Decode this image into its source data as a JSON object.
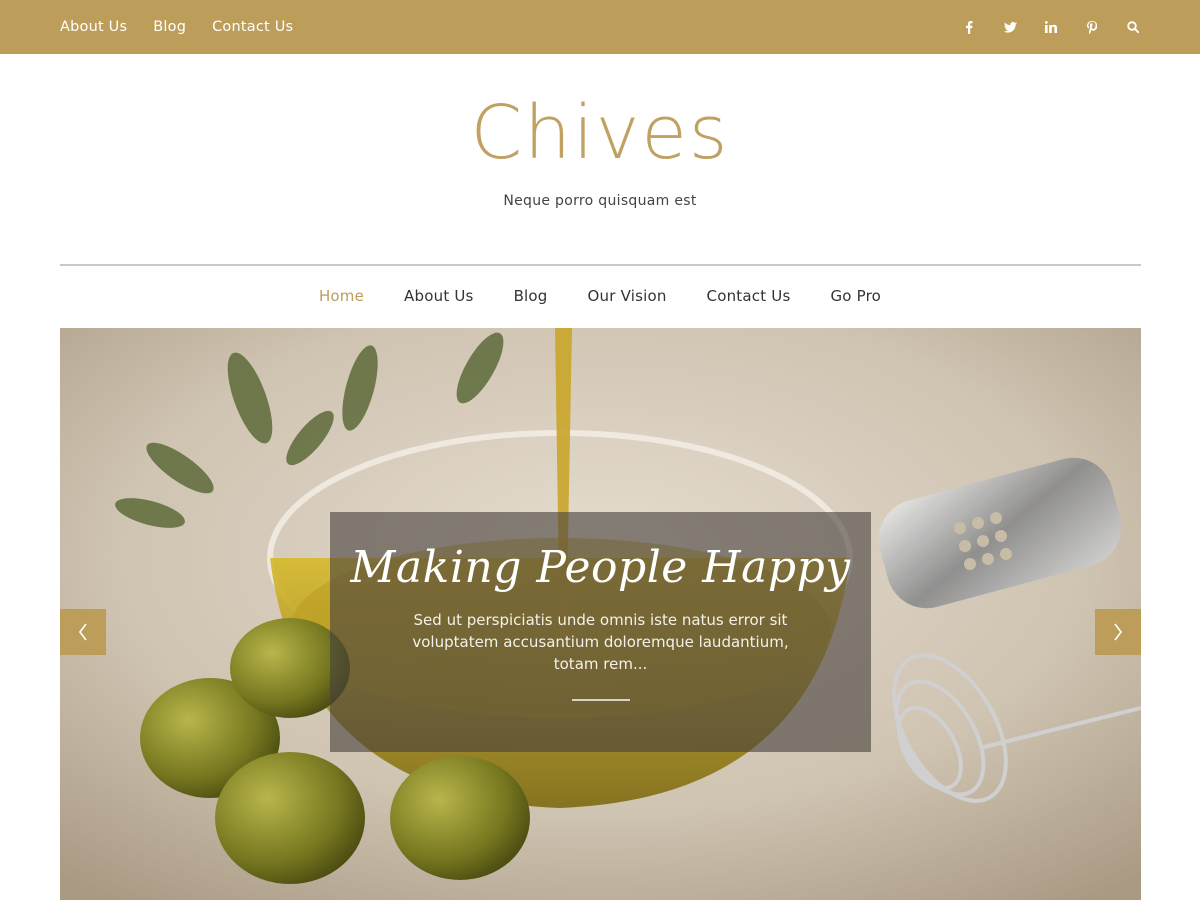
{
  "topbar": {
    "links": [
      "About Us",
      "Blog",
      "Contact Us"
    ],
    "icons": [
      "facebook-icon",
      "twitter-icon",
      "linkedin-icon",
      "pinterest-icon",
      "search-icon"
    ]
  },
  "site": {
    "title": "Chives",
    "tagline": "Neque porro quisquam est"
  },
  "nav": {
    "items": [
      "Home",
      "About Us",
      "Blog",
      "Our Vision",
      "Contact Us",
      "Go Pro"
    ],
    "active": "Home"
  },
  "slider": {
    "title": "Making People Happy",
    "text": "Sed ut perspiciatis unde omnis iste natus error sit voluptatem accusantium doloremque laudantium, totam rem...",
    "prev_icon": "chevron-left-icon",
    "next_icon": "chevron-right-icon"
  },
  "colors": {
    "accent": "#bd9d5a",
    "text": "#333333"
  }
}
